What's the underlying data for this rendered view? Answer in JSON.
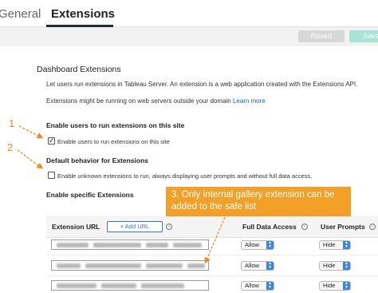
{
  "tabs": [
    {
      "label": "General"
    },
    {
      "label": "Extensions"
    }
  ],
  "toolbar": {
    "revert_label": "Revert",
    "save_label": "Save"
  },
  "section": {
    "title": "Dashboard Extensions",
    "description": "Let users run extensions in Tableau Server. An extension is a web application created with the Extensions API.",
    "warning": "Extensions might be running on web servers outside your domain",
    "learn_more": "Learn more"
  },
  "enable_users": {
    "heading": "Enable users to run extensions on this site",
    "checkbox_label": "Enable users to run extensions on this site",
    "checked": true
  },
  "default_behavior": {
    "heading": "Default behavior for Extensions",
    "checkbox_label": "Enable unknown extensions to run, always displaying user prompts and without full data access.",
    "checked": false
  },
  "specific": {
    "heading": "Enable specific Extensions"
  },
  "annotations": {
    "step1": "1",
    "step2": "2",
    "callout": "3. Only internal gallery extension can be added to the safe list"
  },
  "table": {
    "columns": {
      "url": "Extension URL",
      "add_url": "+ Add URL",
      "full_data": "Full Data Access",
      "user_prompts": "User Prompts"
    },
    "rows": [
      {
        "full_data": "Allow",
        "user_prompts": "Hide"
      },
      {
        "full_data": "Allow",
        "user_prompts": "Hide"
      },
      {
        "full_data": "Allow",
        "user_prompts": "Hide"
      }
    ]
  },
  "colors": {
    "annotation": "#f2a028",
    "link": "#1f5fb3",
    "accent": "#3a86e0"
  }
}
